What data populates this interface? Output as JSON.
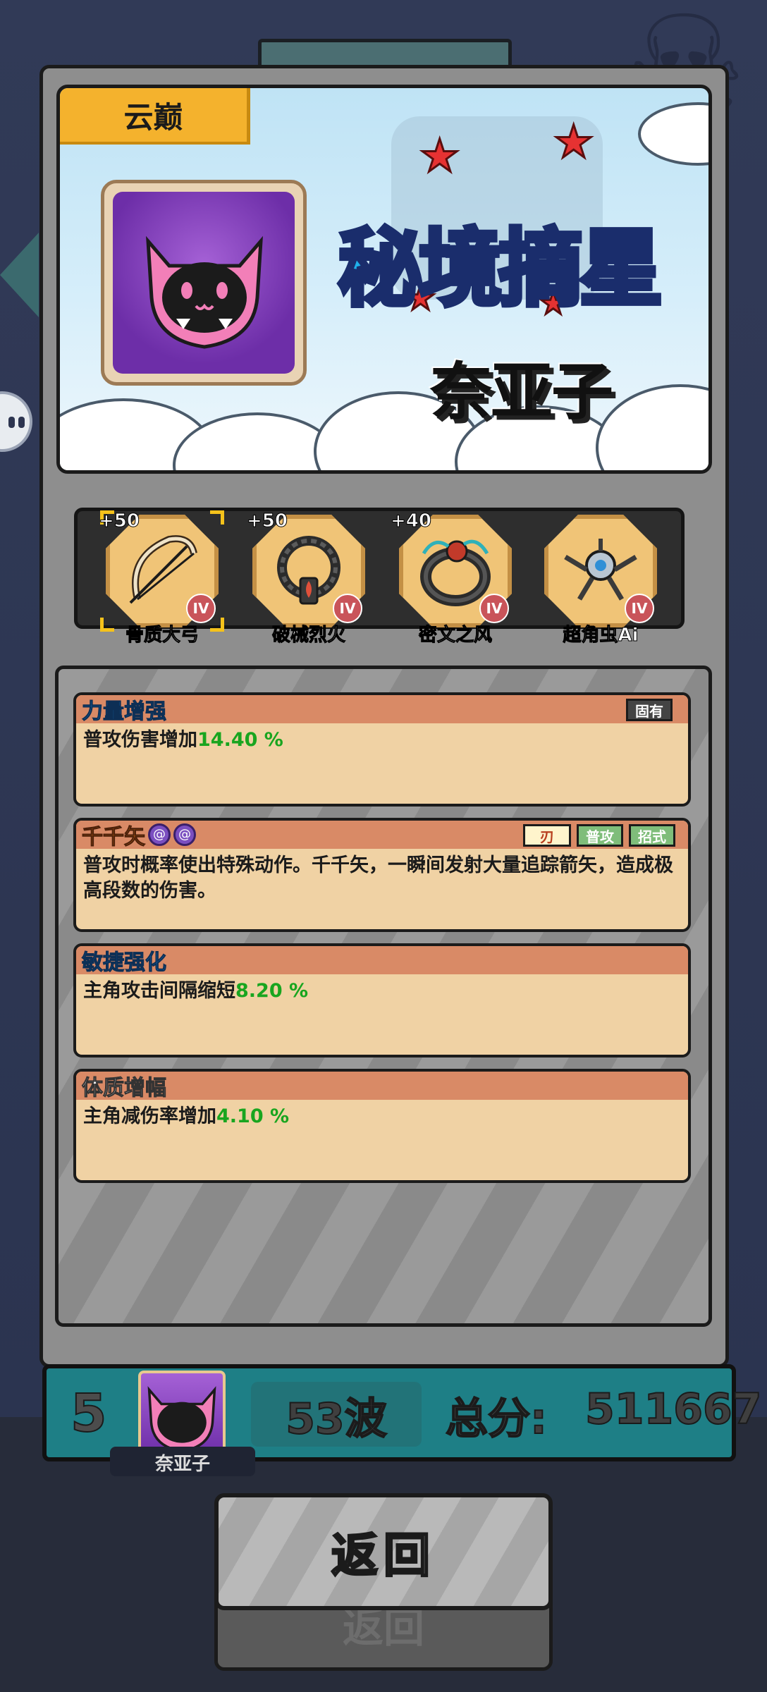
{
  "banner": {
    "label": "云巅",
    "title_art": "秘境摘星",
    "player_name": "奈亚子"
  },
  "equipment": [
    {
      "bonus": "+50",
      "name": "骨质大弓",
      "tier": "IV",
      "icon": "bow-icon"
    },
    {
      "bonus": "+50",
      "name": "破械烈火",
      "tier": "IV",
      "icon": "necklace-icon"
    },
    {
      "bonus": "+40",
      "name": "密文之风",
      "tier": "IV",
      "icon": "ring-icon"
    },
    {
      "bonus": "",
      "name": "超角虫Ai",
      "tier": "IV",
      "icon": "drone-icon"
    }
  ],
  "stats": [
    {
      "title": "力量增强",
      "desc_prefix": "普攻伤害增加",
      "value": "14.40 %",
      "tag": "固有"
    },
    {
      "title": "千千矢",
      "desc": "普攻时概率使出特殊动作。千千矢，一瞬间发射大量追踪箭矢，造成极高段数的伤害。",
      "tags": [
        "刃",
        "普攻",
        "招式"
      ]
    },
    {
      "title": "敏捷强化",
      "desc_prefix": "主角攻击间隔缩短",
      "value": "8.20 %"
    },
    {
      "title": "体质增幅",
      "desc_prefix": "主角减伤率增加",
      "value": "4.10 %"
    }
  ],
  "score": {
    "rank": "5",
    "player_name": "奈亚子",
    "wave": "53波",
    "total_label": "总分:",
    "total_value": "511667"
  },
  "return_label": "返回",
  "colors": {
    "panel": "#8e8e8e",
    "score_bar": "#1e7f86",
    "accent_value": "#19a51f",
    "label_orange": "#f4b22d"
  }
}
